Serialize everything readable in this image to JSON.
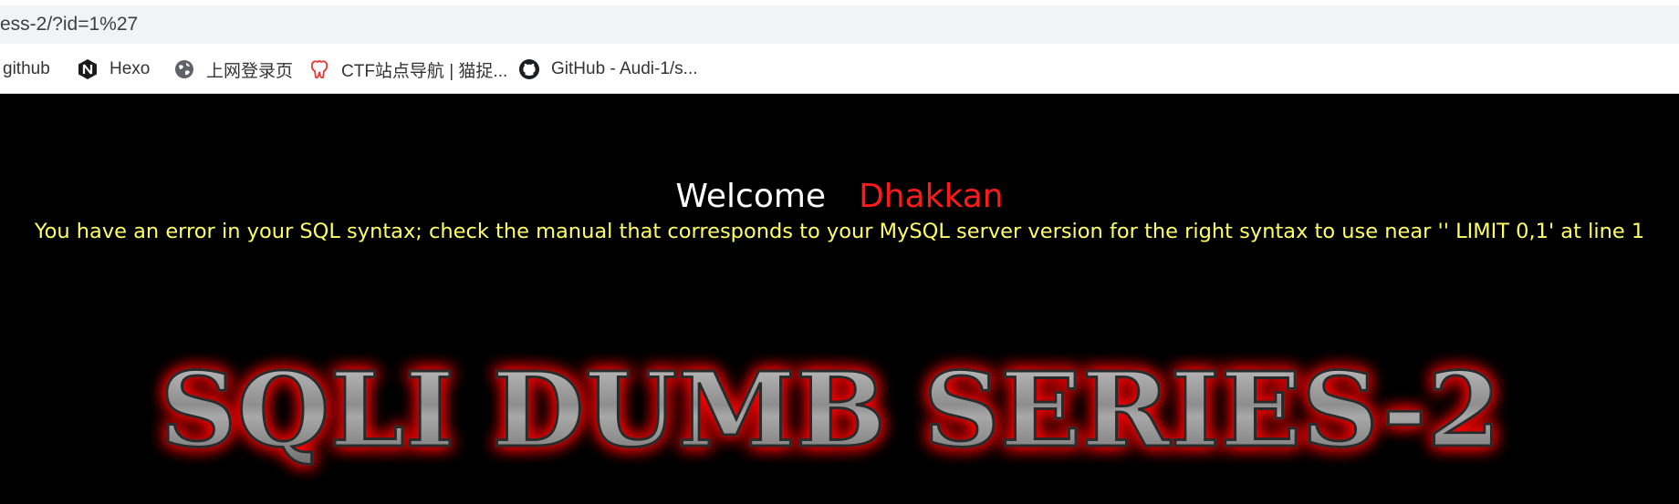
{
  "browser": {
    "url": "ess-2/?id=1%27",
    "bookmarks": [
      {
        "label": "github",
        "icon": "none"
      },
      {
        "label": "Hexo",
        "icon": "hexo-icon"
      },
      {
        "label": "上网登录页",
        "icon": "globe-icon"
      },
      {
        "label": "CTF站点导航 | 猫捉...",
        "icon": "ctf-site-icon"
      },
      {
        "label": "GitHub - Audi-1/s...",
        "icon": "github-icon"
      }
    ]
  },
  "page": {
    "welcome": "Welcome",
    "username": "Dhakkan",
    "error": "You have an error in your SQL syntax; check the manual that corresponds to your MySQL server version for the right syntax to use near '' LIMIT 0,1' at line 1",
    "banner_title": "SQLI DUMB SERIES-2"
  },
  "colors": {
    "page_background": "#000000",
    "welcome_text": "#ffffff",
    "username_text": "#ff1a1a",
    "error_text": "#ffff66",
    "banner_glow": "#ff0000",
    "banner_fill": "#9a9a9a"
  }
}
